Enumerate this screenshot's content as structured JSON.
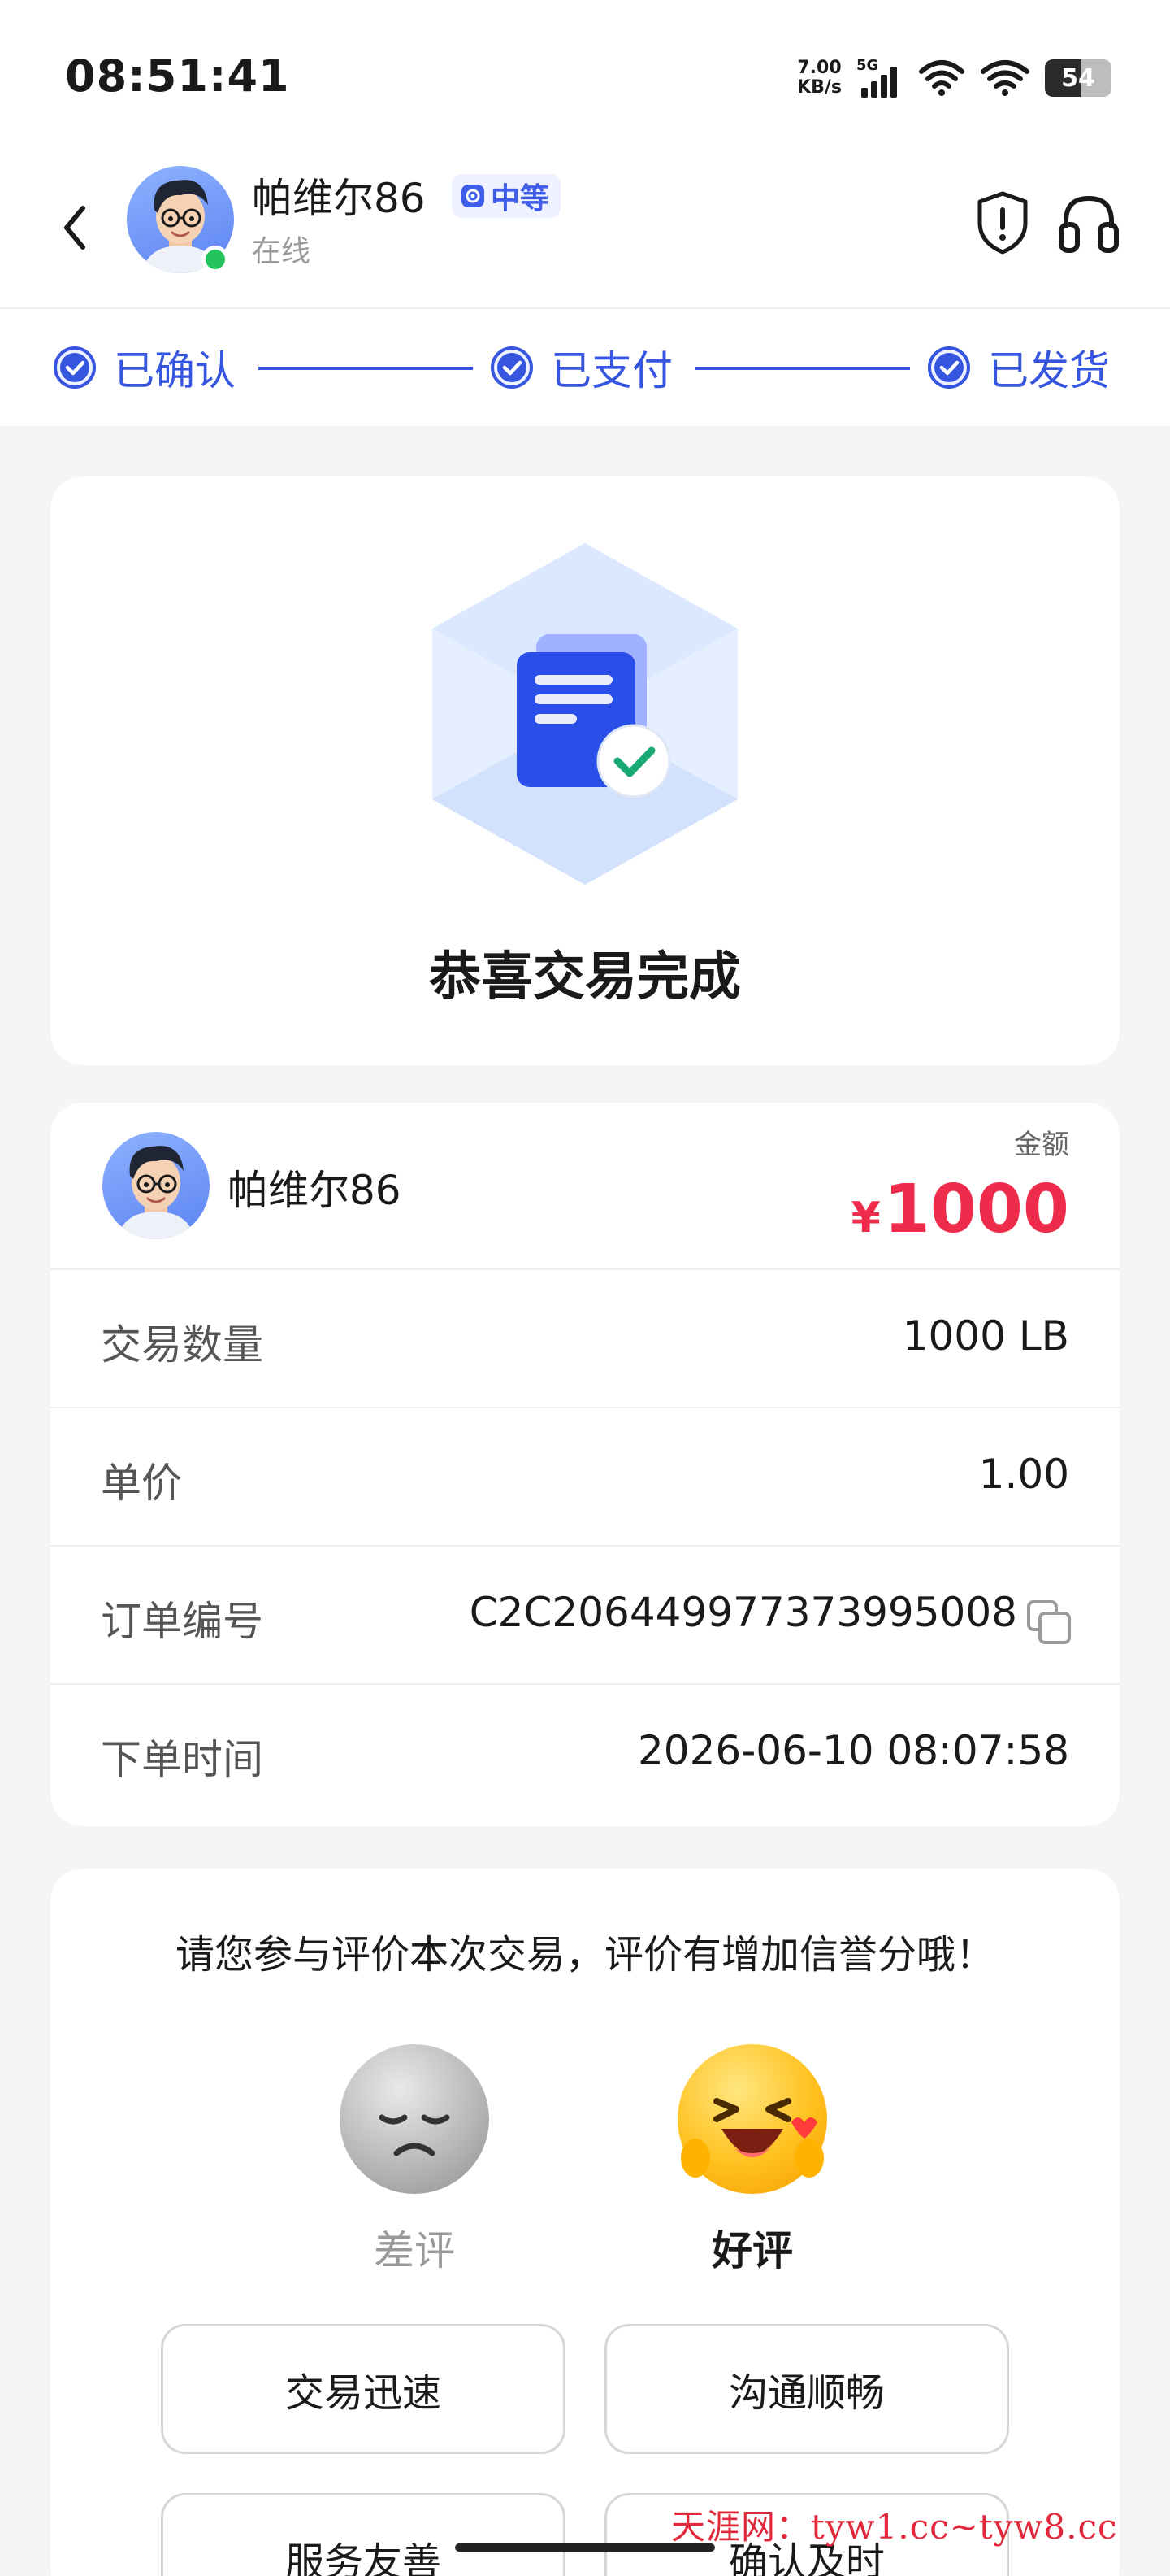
{
  "status_bar": {
    "time": "08:51:41",
    "net_speed_value": "7.00",
    "net_speed_unit": "KB/s",
    "network": "5G",
    "battery": "54",
    "battery_level": 0.54
  },
  "header": {
    "username": "帕维尔86",
    "level": "中等",
    "status": "在线",
    "online_color": "#23c45e"
  },
  "progress": {
    "steps": [
      {
        "label": "已确认"
      },
      {
        "label": "已支付"
      },
      {
        "label": "已发货"
      }
    ],
    "accent": "#3656e0"
  },
  "success": {
    "title": "恭喜交易完成"
  },
  "order": {
    "seller": "帕维尔86",
    "amount_label": "金额",
    "currency": "¥",
    "amount": "1000",
    "amount_color": "#ee2b4b",
    "rows": [
      {
        "label": "交易数量",
        "value": "1000 LB"
      },
      {
        "label": "单价",
        "value": "1.00"
      },
      {
        "label": "订单编号",
        "value": "C2C206449977373995008"
      },
      {
        "label": "下单时间",
        "value": "2026-06-10 08:07:58"
      }
    ]
  },
  "review": {
    "prompt": "请您参与评价本次交易，评价有增加信誉分哦！",
    "bad_label": "差评",
    "good_label": "好评",
    "tags": [
      "交易迅速",
      "沟通顺畅",
      "服务友善",
      "确认及时"
    ]
  },
  "watermark": "天涯网：tyw1.cc~tyw8.cc"
}
